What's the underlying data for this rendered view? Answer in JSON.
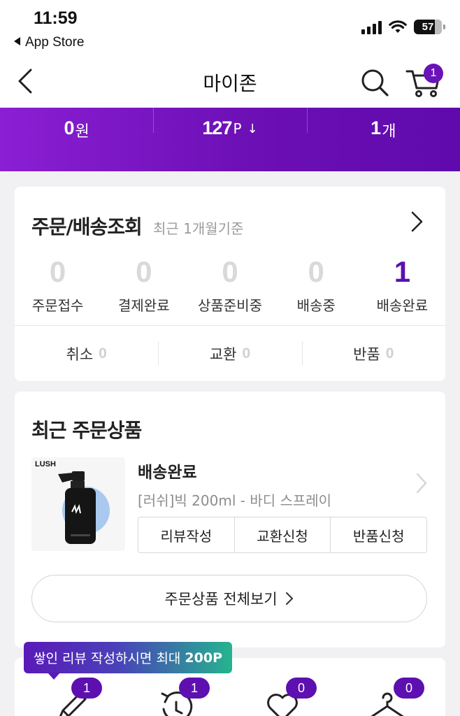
{
  "status_bar": {
    "time": "11:59",
    "back_app": "App Store",
    "battery": "57"
  },
  "header": {
    "title": "마이존",
    "cart_count": "1"
  },
  "summary": [
    {
      "value": "0",
      "unit": "원",
      "arrow": ""
    },
    {
      "value": "127",
      "unit": "P",
      "arrow": "↓"
    },
    {
      "value": "1",
      "unit": "개",
      "arrow": ""
    }
  ],
  "orders": {
    "title": "주문/배송조회",
    "subtitle": "최근 1개월기준",
    "statuses": [
      {
        "label": "주문접수",
        "count": "0"
      },
      {
        "label": "결제완료",
        "count": "0"
      },
      {
        "label": "상품준비중",
        "count": "0"
      },
      {
        "label": "배송중",
        "count": "0"
      },
      {
        "label": "배송완료",
        "count": "1"
      }
    ],
    "claims": [
      {
        "label": "취소",
        "count": "0"
      },
      {
        "label": "교환",
        "count": "0"
      },
      {
        "label": "반품",
        "count": "0"
      }
    ]
  },
  "recent": {
    "title": "최근 주문상품",
    "brand_logo_text": "LUSH",
    "status": "배송완료",
    "product_name": "[러쉬]빅 200ml - 바디 스프레이",
    "actions": [
      "리뷰작성",
      "교환신청",
      "반품신청"
    ],
    "view_all": "주문상품 전체보기"
  },
  "tooltip": {
    "text": "쌓인 리뷰 작성하시면 최대",
    "highlight": "200P"
  },
  "menu_badges": [
    "1",
    "1",
    "0",
    "0"
  ],
  "colors": {
    "accent": "#5d0fb0",
    "band_start": "#8a1fd3",
    "band_end": "#5f0aad"
  }
}
